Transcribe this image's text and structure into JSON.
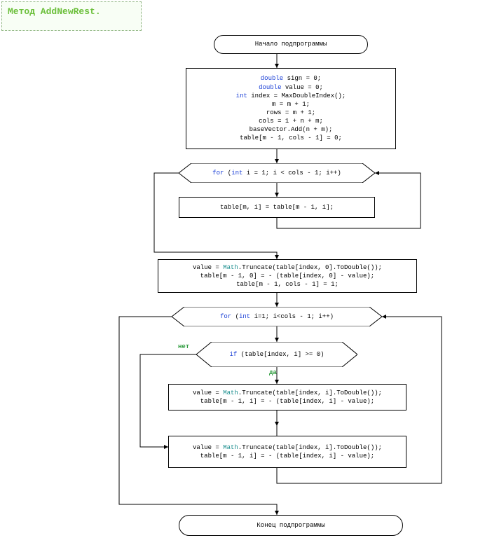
{
  "title": "Метод AddNewRest.",
  "start": "Начало подпрограммы",
  "proc1": {
    "l1a": "double",
    "l1b": " sign = 0;",
    "l2a": "double",
    "l2b": " value = 0;",
    "l3a": "int",
    "l3b": " index = MaxDoubleIndex();",
    "l4": "m = m + 1;",
    "l5": "rows = m + 1;",
    "l6": "cols = 1 + n + m;",
    "l7": "baseVector.Add(n + m);",
    "l8": "table[m - 1, cols - 1] = 0;"
  },
  "loop1": {
    "a": "for",
    "b": " (",
    "c": "int",
    "d": " i = 1; i < cols - 1; i++)"
  },
  "proc2": "table[m, i] = table[m - 1, i];",
  "proc3": {
    "l1a": "value = ",
    "l1b": "Math",
    "l1c": ".Truncate(table[index, 0].ToDouble());",
    "l2": "table[m - 1, 0] = - (table[index, 0] - value);",
    "l3": "table[m - 1, cols - 1] = 1;"
  },
  "loop2": {
    "a": "for",
    "b": " (",
    "c": "int",
    "d": " i=1; i<cols - 1; i++)"
  },
  "cond": {
    "a": "if",
    "b": " (table[index, i] >= 0)"
  },
  "labelYes": "да",
  "labelNo": "нет",
  "proc4": {
    "l1a": "value = ",
    "l1b": "Math",
    "l1c": ".Truncate(table[index, i].ToDouble());",
    "l2": "table[m - 1, i] = - (table[index, i] - value);"
  },
  "proc5": {
    "l1a": "value = ",
    "l1b": "Math",
    "l1c": ".Truncate(table[index, i].ToDouble());",
    "l2": "table[m - 1, i] = - (table[index, i] - value);"
  },
  "end": "Конец подпрограммы"
}
